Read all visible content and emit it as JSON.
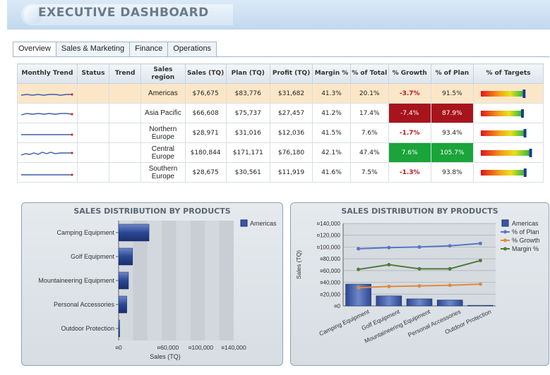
{
  "header": {
    "title": "EXECUTIVE DASHBOARD"
  },
  "tabs": [
    "Overview",
    "Sales & Marketing",
    "Finance",
    "Operations"
  ],
  "table": {
    "columns": [
      "Monthly Trend",
      "Status",
      "Trend",
      "Sales region",
      "Sales (TQ)",
      "Plan (TQ)",
      "Profit (TQ)",
      "Margin %",
      "% of Total",
      "% Growth",
      "% of Plan",
      "% of Targets"
    ],
    "rows": [
      {
        "region": "Americas",
        "sales": "$76,675",
        "plan": "$83,776",
        "profit": "$31,682",
        "margin": "41.3%",
        "total": "20.1%",
        "growth": "-3.7%",
        "ofplan": "91.5%",
        "target": 0.915
      },
      {
        "region": "Asia Pacific",
        "sales": "$66,608",
        "plan": "$75,737",
        "profit": "$27,457",
        "margin": "41.2%",
        "total": "17.4%",
        "growth": "-7.4%",
        "ofplan": "87.9%",
        "target": 0.879
      },
      {
        "region": "Northern Europe",
        "sales": "$28,971",
        "plan": "$31,016",
        "profit": "$12,036",
        "margin": "41.5%",
        "total": "7.6%",
        "growth": "-1.7%",
        "ofplan": "93.4%",
        "target": 0.934
      },
      {
        "region": "Central Europe",
        "sales": "$180,844",
        "plan": "$171,171",
        "profit": "$76,180",
        "margin": "42.1%",
        "total": "47.4%",
        "growth": "7.6%",
        "ofplan": "105.7%",
        "target": 1.057
      },
      {
        "region": "Southern Europe",
        "sales": "$28,675",
        "plan": "$30,561",
        "profit": "$11,919",
        "margin": "41.6%",
        "total": "7.5%",
        "growth": "-1.3%",
        "ofplan": "93.8%",
        "target": 0.938
      }
    ]
  },
  "chart_data": [
    {
      "type": "bar",
      "title": "SALES DISTRIBUTION BY PRODUCTS",
      "orientation": "horizontal",
      "categories": [
        "Camping Equipment",
        "Golf Equipment",
        "Mountaineering Equipment",
        "Personal Accessories",
        "Outdoor Protection"
      ],
      "series": [
        {
          "name": "Americas",
          "values": [
            37000,
            17000,
            12000,
            10000,
            1000
          ],
          "color": "#3a57a8"
        }
      ],
      "xlabel": "Sales (TQ)",
      "xticks": [
        "¤0",
        "¤60,000",
        "¤100,000",
        "¤140,000"
      ],
      "xlim": [
        0,
        140000
      ],
      "legend": "top-right"
    },
    {
      "type": "bar+line",
      "title": "SALES DISTRIBUTION BY PRODUCTS",
      "categories": [
        "Camping Equipment",
        "Golf Equipment",
        "Mountaineering Equipment",
        "Personal Accessories",
        "Outdoor Protection"
      ],
      "ylabel": "Sales (TQ)",
      "ylim": [
        0,
        140000
      ],
      "yticks": [
        "¤140,000",
        "¤120,000",
        "¤100,000",
        "¤80,000",
        "¤60,000",
        "¤40,000",
        "¤20,000",
        "¤0"
      ],
      "series": [
        {
          "name": "Americas",
          "kind": "bar",
          "color": "#3a57a8",
          "values": [
            37000,
            17000,
            12000,
            10000,
            1000
          ]
        },
        {
          "name": "% of Plan",
          "kind": "line",
          "color": "#5677c4",
          "values": [
            97000,
            99000,
            100000,
            102000,
            106000
          ]
        },
        {
          "name": "% Growth",
          "kind": "line",
          "color": "#e08a3c",
          "values": [
            31000,
            33000,
            34000,
            35000,
            37000
          ]
        },
        {
          "name": "Margin %",
          "kind": "line",
          "color": "#4f7c3a",
          "values": [
            62000,
            70000,
            63000,
            63000,
            77000
          ]
        }
      ],
      "legend": "right"
    }
  ]
}
